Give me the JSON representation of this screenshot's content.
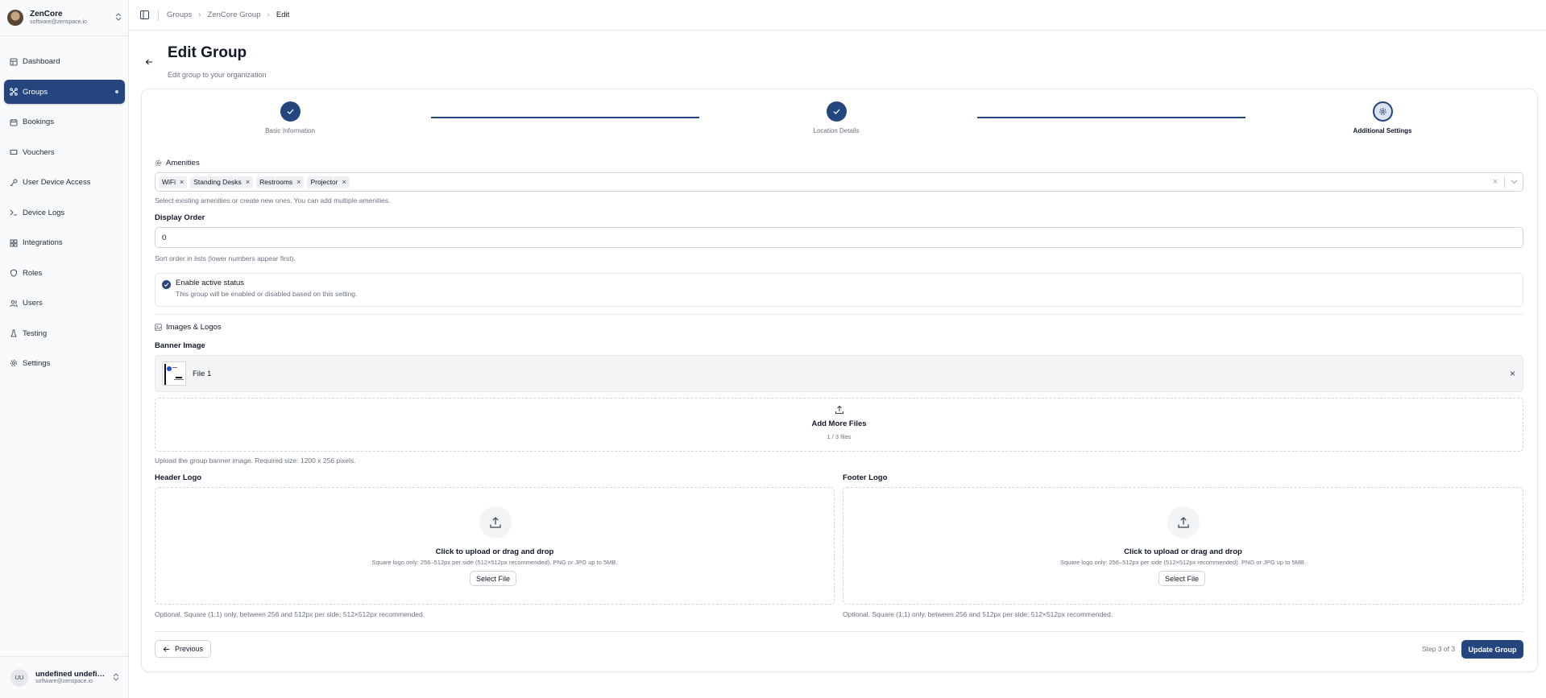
{
  "sidebar": {
    "brand": {
      "name": "ZenCore",
      "email": "software@zenspace.io"
    },
    "items": [
      {
        "label": "Dashboard",
        "icon": "dashboard-icon"
      },
      {
        "label": "Groups",
        "icon": "groups-icon",
        "active": true
      },
      {
        "label": "Bookings",
        "icon": "calendar-icon"
      },
      {
        "label": "Vouchers",
        "icon": "ticket-icon"
      },
      {
        "label": "User Device Access",
        "icon": "key-icon"
      },
      {
        "label": "Device Logs",
        "icon": "terminal-icon"
      },
      {
        "label": "Integrations",
        "icon": "integrations-icon"
      },
      {
        "label": "Roles",
        "icon": "shield-icon"
      },
      {
        "label": "Users",
        "icon": "users-icon"
      },
      {
        "label": "Testing",
        "icon": "flask-icon"
      },
      {
        "label": "Settings",
        "icon": "gear-icon"
      }
    ],
    "user": {
      "initials": "UU",
      "name": "undefined undefined",
      "email": "software@zenspace.io"
    }
  },
  "breadcrumb": [
    "Groups",
    "ZenCore Group",
    "Edit"
  ],
  "header": {
    "title": "Edit Group",
    "subtitle": "Edit group to your organization"
  },
  "steps": [
    {
      "label": "Basic Information",
      "state": "complete"
    },
    {
      "label": "Location Details",
      "state": "complete"
    },
    {
      "label": "Additional Settings",
      "state": "current"
    }
  ],
  "amenities": {
    "title": "Amenities",
    "chips": [
      "WiFi",
      "Standing Desks",
      "Restrooms",
      "Projector"
    ],
    "help": "Select existing amenities or create new ones. You can add multiple amenities."
  },
  "display_order": {
    "label": "Display Order",
    "value": "0",
    "help": "Sort order in lists (lower numbers appear first)."
  },
  "active_status": {
    "label": "Enable active status",
    "description": "This group will be enabled or disabled based on this setting.",
    "checked": true
  },
  "images": {
    "title": "Images & Logos",
    "banner": {
      "label": "Banner Image",
      "file_name": "File 1",
      "add_more": "Add More Files",
      "count": "1 / 3 files",
      "help": "Upload the group banner image. Required size: 1200 x 256 pixels."
    },
    "header_logo": {
      "label": "Header Logo",
      "drop_title": "Click to upload or drag and drop",
      "drop_sub": "Square logo only: 256–512px per side (512×512px recommended). PNG or JPG up to 5MB.",
      "button": "Select File",
      "help": "Optional. Square (1:1) only, between 256 and 512px per side; 512×512px recommended."
    },
    "footer_logo": {
      "label": "Footer Logo",
      "drop_title": "Click to upload or drag and drop",
      "drop_sub": "Square logo only: 256–512px per side (512×512px recommended). PNG or JPG up to 5MB.",
      "button": "Select File",
      "help": "Optional. Square (1:1) only, between 256 and 512px per side; 512×512px recommended."
    }
  },
  "footer": {
    "previous": "Previous",
    "step_text": "Step 3 of 3",
    "submit": "Update Group"
  },
  "colors": {
    "primary": "#24457e",
    "border": "#e5e7eb",
    "muted": "#6b7280"
  }
}
